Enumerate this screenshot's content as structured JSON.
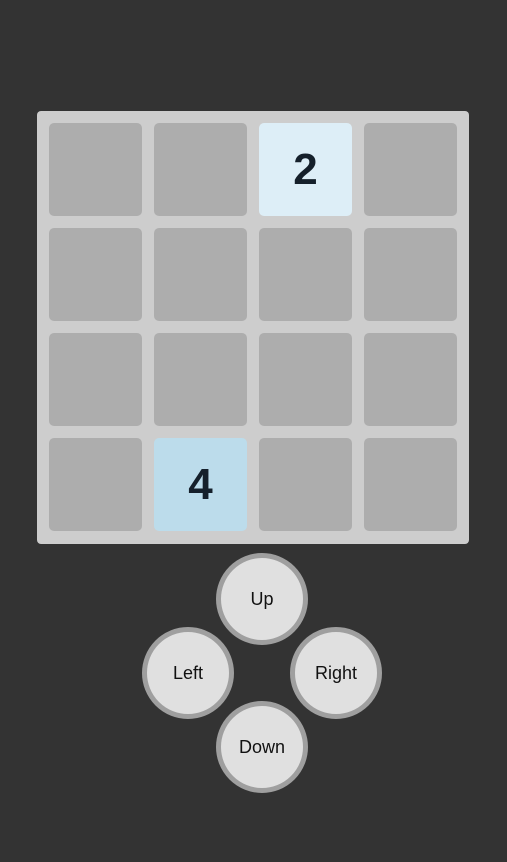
{
  "board": {
    "rows": [
      [
        "",
        "",
        "2",
        ""
      ],
      [
        "",
        "",
        "",
        ""
      ],
      [
        "",
        "",
        "",
        ""
      ],
      [
        "",
        "4",
        "",
        ""
      ]
    ]
  },
  "tile_colors": {
    "empty": "#adadad",
    "2": "#ddeef7",
    "4": "#bcdceb"
  },
  "controls": {
    "up_label": "Up",
    "left_label": "Left",
    "right_label": "Right",
    "down_label": "Down"
  }
}
